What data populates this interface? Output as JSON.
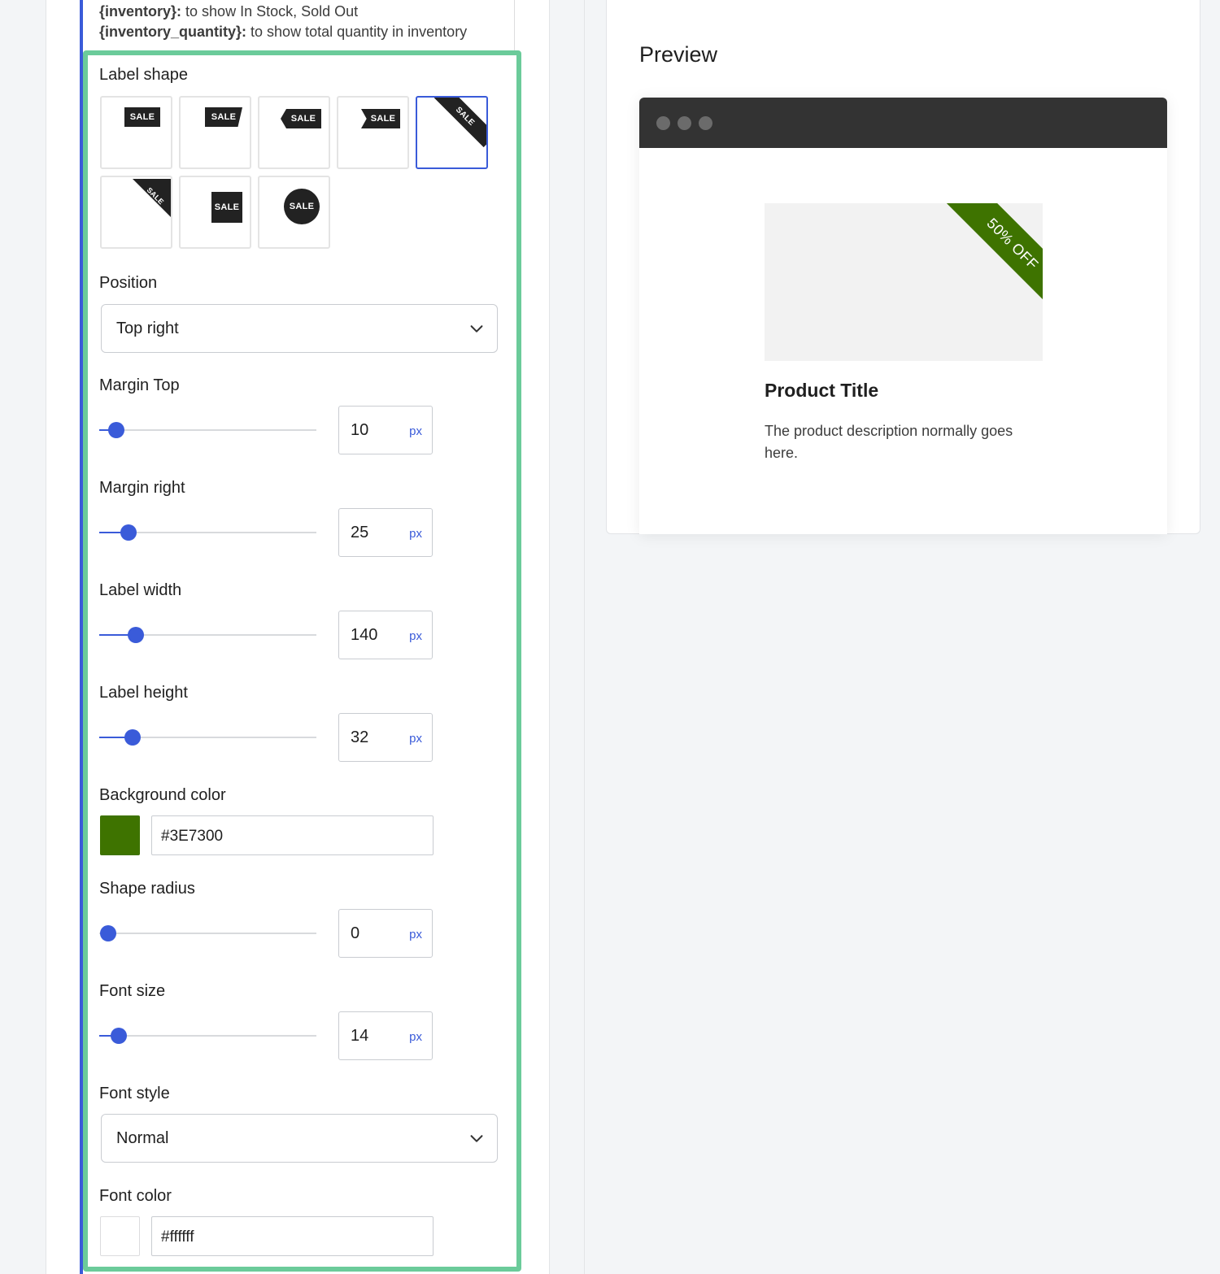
{
  "help": {
    "line1_code": "{inventory}:",
    "line1_text": " to show In Stock, Sold Out",
    "line2_code": "{inventory_quantity}:",
    "line2_text": " to show total quantity in inventory"
  },
  "label_shape": {
    "label": "Label shape",
    "tag_text": "SALE",
    "selected_index": 4
  },
  "position": {
    "label": "Position",
    "value": "Top right"
  },
  "margin_top": {
    "label": "Margin Top",
    "value": "10",
    "unit": "px"
  },
  "margin_right": {
    "label": "Margin right",
    "value": "25",
    "unit": "px"
  },
  "label_width": {
    "label": "Label width",
    "value": "140",
    "unit": "px"
  },
  "label_height": {
    "label": "Label height",
    "value": "32",
    "unit": "px"
  },
  "background_color": {
    "label": "Background color",
    "value": "#3E7300",
    "swatch": "#3e7300"
  },
  "shape_radius": {
    "label": "Shape radius",
    "value": "0",
    "unit": "px"
  },
  "font_size": {
    "label": "Font size",
    "value": "14",
    "unit": "px"
  },
  "font_style": {
    "label": "Font style",
    "value": "Normal"
  },
  "font_color": {
    "label": "Font color",
    "value": "#ffffff",
    "swatch": "#ffffff"
  },
  "preview": {
    "title": "Preview",
    "ribbon_text": "50% OFF",
    "product_title": "Product Title",
    "product_description": "The product description normally goes here."
  },
  "colors": {
    "accent": "#3a5bd9",
    "panel_border": "#6bcb9a",
    "browser_bar": "#333333"
  }
}
